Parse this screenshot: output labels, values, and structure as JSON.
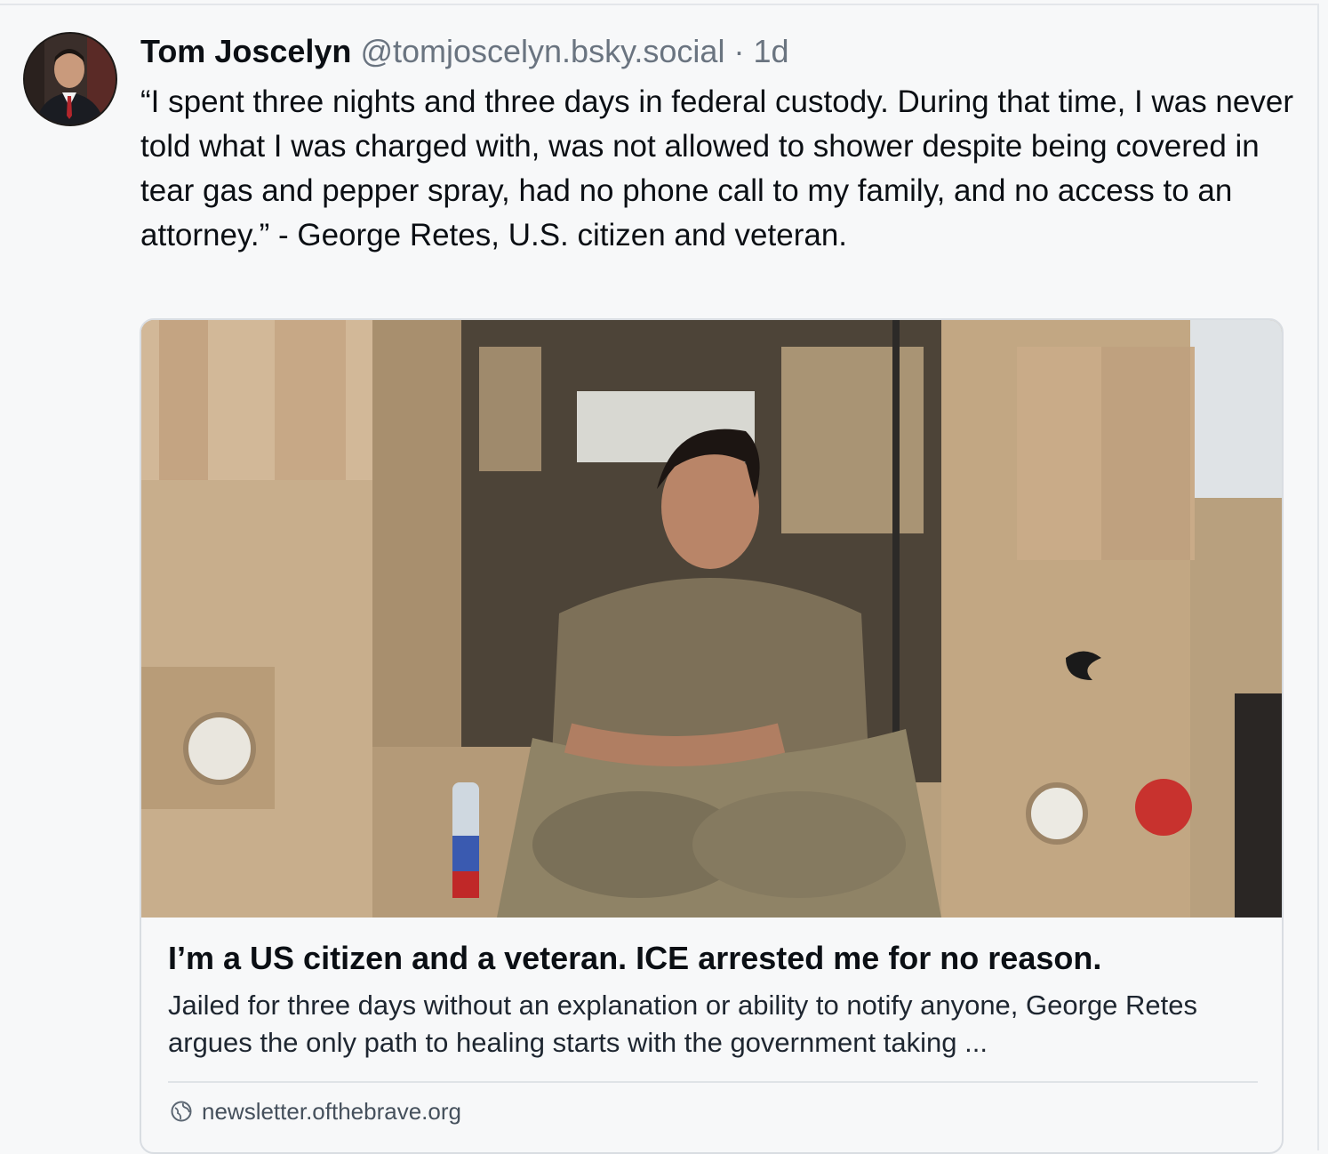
{
  "post": {
    "author_name": "Tom Joscelyn",
    "handle": "@tomjoscelyn.bsky.social",
    "separator": "·",
    "time": "1d",
    "text": "“I spent three nights and three days in federal custody. During that time, I was never told what I was charged with, was not allowed to shower despite being covered in tear gas and pepper spray, had no phone call to my family, and no access to an attorney.” - George Retes, U.S. citizen and veteran."
  },
  "link_card": {
    "title": "I’m a US citizen and a veteran. ICE arrested me for no reason.",
    "description": "Jailed for three days without an explanation or ability to notify anyone, George Retes argues the only path to healing starts with the government taking ...",
    "domain": "newsletter.ofthebrave.org",
    "domain_icon": "globe-icon"
  },
  "colors": {
    "background": "#f7f8f9",
    "text": "#0b0f14",
    "muted": "#6a7480",
    "border": "#d9dde2"
  }
}
